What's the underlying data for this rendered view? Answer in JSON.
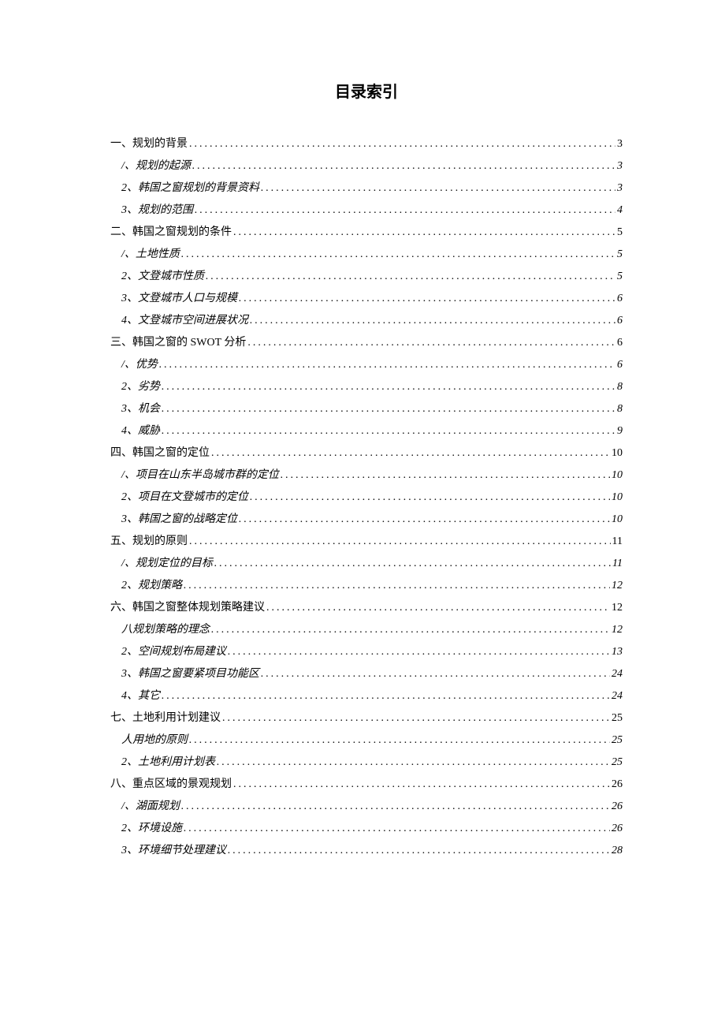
{
  "title": "目录索引",
  "entries": [
    {
      "label": "一、规划的背景",
      "page": "3",
      "level": 1
    },
    {
      "label": "/、规划的起源",
      "page": "3",
      "level": 2
    },
    {
      "label": "2、韩国之窗规划的背景资料",
      "page": "3",
      "level": 2
    },
    {
      "label": "3、规划的范围",
      "page": "4",
      "level": 2
    },
    {
      "label": "二、韩国之窗规划的条件",
      "page": "5",
      "level": 1
    },
    {
      "label": "/、土地性质",
      "page": "5",
      "level": 2
    },
    {
      "label": "2、文登城市性质",
      "page": "5",
      "level": 2
    },
    {
      "label": "3、文登城市人口与规模",
      "page": "6",
      "level": 2
    },
    {
      "label": "4、文登城市空间进展状况",
      "page": "6",
      "level": 2
    },
    {
      "label": "三、韩国之窗的 SWOT 分析",
      "page": "6",
      "level": 1,
      "swot": true
    },
    {
      "label": "/、优势",
      "page": "6",
      "level": 2
    },
    {
      "label": "2、劣势",
      "page": "8",
      "level": 2
    },
    {
      "label": "3、机会",
      "page": "8",
      "level": 2
    },
    {
      "label": "4、威胁",
      "page": "9",
      "level": 2
    },
    {
      "label": "四、韩国之窗的定位",
      "page": "10",
      "level": 1
    },
    {
      "label": "/、项目在山东半岛城市群的定位",
      "page": "10",
      "level": 2
    },
    {
      "label": "2、项目在文登城市的定位",
      "page": "10",
      "level": 2
    },
    {
      "label": "3、韩国之窗的战略定位",
      "page": "10",
      "level": 2
    },
    {
      "label": "五、规划的原则",
      "page": "11",
      "level": 1
    },
    {
      "label": "/、规划定位的目标",
      "page": "11",
      "level": 2
    },
    {
      "label": "2、规划策略",
      "page": "12",
      "level": 2
    },
    {
      "label": "六、韩国之窗整体规划策略建议",
      "page": "12",
      "level": 1
    },
    {
      "label": "八规划策略的理念",
      "page": "12",
      "level": 2
    },
    {
      "label": "2、空间规划布局建议",
      "page": "13",
      "level": 2
    },
    {
      "label": "3、韩国之窗要紧项目功能区",
      "page": "24",
      "level": 2
    },
    {
      "label": "4、其它",
      "page": "24",
      "level": 2
    },
    {
      "label": "七、土地利用计划建议",
      "page": "25",
      "level": 1
    },
    {
      "label": "人用地的原则",
      "page": "25",
      "level": 2
    },
    {
      "label": "2、土地利用计划表",
      "page": "25",
      "level": 2
    },
    {
      "label": "八、重点区域的景观规划",
      "page": "26",
      "level": 1
    },
    {
      "label": "/、湖面规划",
      "page": "26",
      "level": 2
    },
    {
      "label": "2、环境设施",
      "page": "26",
      "level": 2
    },
    {
      "label": "3、环境细节处理建议",
      "page": "28",
      "level": 2
    }
  ]
}
